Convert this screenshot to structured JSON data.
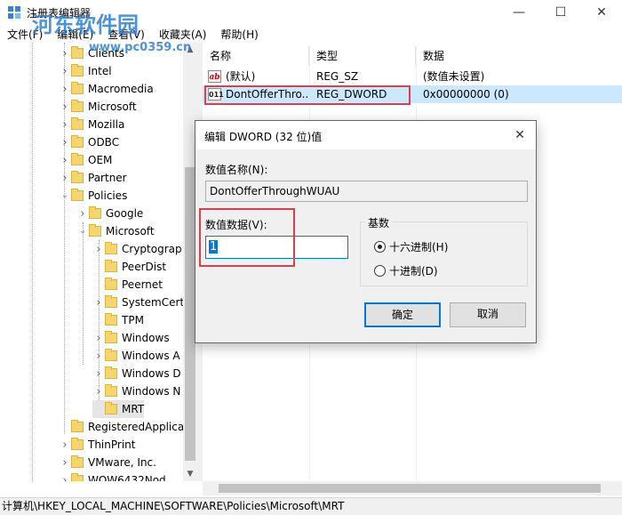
{
  "window": {
    "title": "注册表编辑器",
    "minimize_glyph": "—",
    "maximize_glyph": "☐",
    "close_glyph": "✕"
  },
  "watermark": {
    "line1": "河东软件园",
    "line2": "www.pc0359.cn"
  },
  "menu": [
    "文件(F)",
    "编辑(E)",
    "查看(V)",
    "收藏夹(A)",
    "帮助(H)"
  ],
  "tree": {
    "items": [
      {
        "label": "Clients",
        "level": 1,
        "expandable": true
      },
      {
        "label": "Intel",
        "level": 1,
        "expandable": true
      },
      {
        "label": "Macromedia",
        "level": 1,
        "expandable": true
      },
      {
        "label": "Microsoft",
        "level": 1,
        "expandable": true
      },
      {
        "label": "Mozilla",
        "level": 1,
        "expandable": true
      },
      {
        "label": "ODBC",
        "level": 1,
        "expandable": true
      },
      {
        "label": "OEM",
        "level": 1,
        "expandable": true
      },
      {
        "label": "Partner",
        "level": 1,
        "expandable": true
      },
      {
        "label": "Policies",
        "level": 1,
        "expandable": true,
        "expanded": true
      },
      {
        "label": "Google",
        "level": 2,
        "expandable": true
      },
      {
        "label": "Microsoft",
        "level": 2,
        "expandable": true,
        "expanded": true
      },
      {
        "label": "Cryptograp",
        "level": 3,
        "expandable": true
      },
      {
        "label": "PeerDist",
        "level": 3,
        "expandable": false
      },
      {
        "label": "Peernet",
        "level": 3,
        "expandable": false
      },
      {
        "label": "SystemCert",
        "level": 3,
        "expandable": true
      },
      {
        "label": "TPM",
        "level": 3,
        "expandable": false
      },
      {
        "label": "Windows",
        "level": 3,
        "expandable": true
      },
      {
        "label": "Windows A",
        "level": 3,
        "expandable": true
      },
      {
        "label": "Windows D",
        "level": 3,
        "expandable": true
      },
      {
        "label": "Windows N",
        "level": 3,
        "expandable": true
      },
      {
        "label": "MRT",
        "level": 3,
        "expandable": false,
        "selected": true
      },
      {
        "label": "RegisteredApplica",
        "level": 1,
        "expandable": false
      },
      {
        "label": "ThinPrint",
        "level": 1,
        "expandable": true
      },
      {
        "label": "VMware, Inc.",
        "level": 1,
        "expandable": true
      },
      {
        "label": "WOW6432Nod",
        "level": 1,
        "expandable": true
      }
    ]
  },
  "list": {
    "columns": [
      "名称",
      "类型",
      "数据"
    ],
    "rows": [
      {
        "icon": "ab",
        "name": "(默认)",
        "type": "REG_SZ",
        "data": "(数值未设置)"
      },
      {
        "icon": "bin",
        "name": "DontOfferThro...",
        "type": "REG_DWORD",
        "data": "0x00000000 (0)",
        "selected": true
      }
    ]
  },
  "status": "计算机\\HKEY_LOCAL_MACHINE\\SOFTWARE\\Policies\\Microsoft\\MRT",
  "dialog": {
    "title": "编辑 DWORD (32 位)值",
    "close_glyph": "✕",
    "name_label": "数值名称(N):",
    "name_value": "DontOfferThroughWUAU",
    "data_label": "数值数据(V):",
    "data_value": "1",
    "base_label": "基数",
    "hex_label": "十六进制(H)",
    "dec_label": "十进制(D)",
    "selected_base": "hex",
    "ok_label": "确定",
    "cancel_label": "取消"
  },
  "colors": {
    "accent": "#0078d7",
    "highlight_box": "#d9414a",
    "row_selected": "#cce8ff",
    "folder": "#f6d66c"
  }
}
